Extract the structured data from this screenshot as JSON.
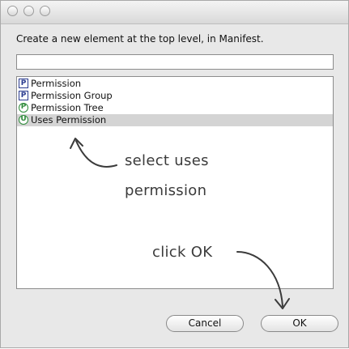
{
  "dialog": {
    "prompt": "Create a new element at the top level, in Manifest.",
    "name_field_value": ""
  },
  "element_list": {
    "items": [
      {
        "badge": "P",
        "badge_shape": "square",
        "label": "Permission"
      },
      {
        "badge": "P",
        "badge_shape": "square",
        "label": "Permission Group"
      },
      {
        "badge": "P",
        "badge_shape": "circle",
        "label": "Permission Tree"
      },
      {
        "badge": "U",
        "badge_shape": "circle",
        "label": "Uses Permission",
        "selected": true
      }
    ]
  },
  "annotations": {
    "select_line1": "select uses",
    "select_line2": "permission",
    "click_ok": "click OK"
  },
  "buttons": {
    "cancel": "Cancel",
    "ok": "OK"
  },
  "colors": {
    "badge_square": "#2a3b8f",
    "badge_circle": "#2e8b3a",
    "selection": "#d4d4d4"
  }
}
